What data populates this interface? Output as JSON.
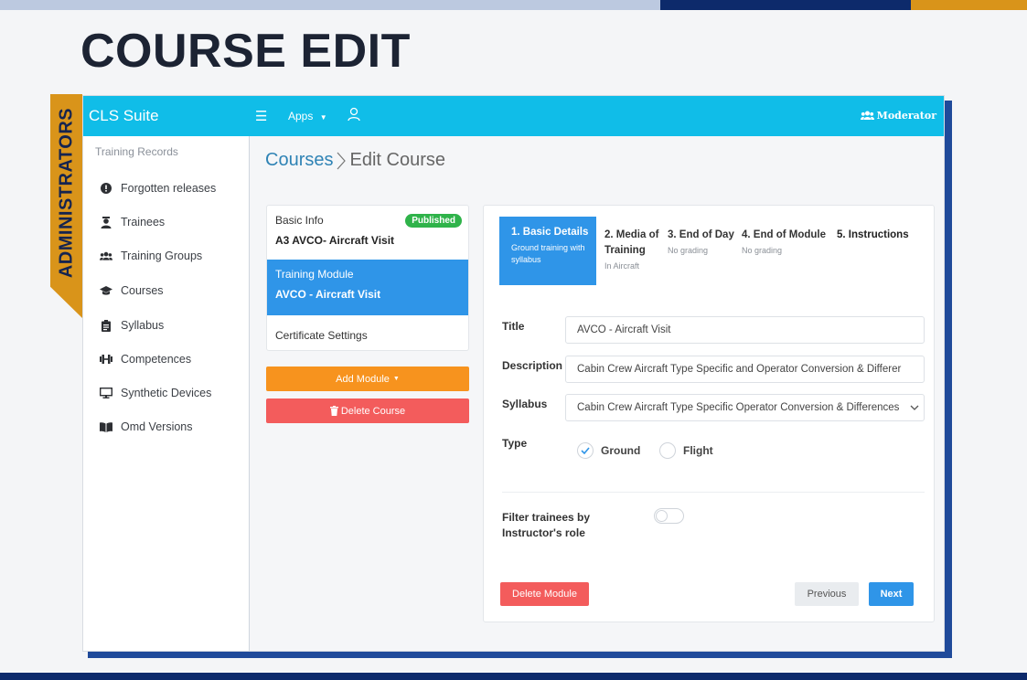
{
  "slide": {
    "title": "COURSE EDIT",
    "side_tab": "ADMINISTRATORS"
  },
  "colors": {
    "accent": "#10bde8",
    "primary_blue": "#2f95e8",
    "orange": "#f7931e",
    "danger": "#f35c5c",
    "success": "#2fb34a",
    "navy": "#0d2a6b",
    "gold": "#d9941a"
  },
  "navbar": {
    "brand": "CLS Suite",
    "menu_icon": "hamburger-icon",
    "apps_label": "Apps",
    "user_icon": "user-icon",
    "role_label": "Moderator",
    "role_icon": "users-icon"
  },
  "sidebar": {
    "heading": "Training Records",
    "items": [
      {
        "label": "Forgotten releases",
        "icon": "exclamation-circle-icon"
      },
      {
        "label": "Trainees",
        "icon": "user-graduate-icon"
      },
      {
        "label": "Training Groups",
        "icon": "users-icon"
      },
      {
        "label": "Courses",
        "icon": "graduation-cap-icon"
      },
      {
        "label": "Syllabus",
        "icon": "clipboard-icon"
      },
      {
        "label": "Competences",
        "icon": "dumbbell-icon"
      },
      {
        "label": "Synthetic Devices",
        "icon": "monitor-icon"
      },
      {
        "label": "Omd Versions",
        "icon": "book-icon"
      }
    ]
  },
  "breadcrumb": {
    "parent": "Courses",
    "current": "Edit Course"
  },
  "module_card": {
    "basic_label": "Basic Info",
    "badge": "Published",
    "course_title": "A3 AVCO- Aircraft Visit",
    "module_label": "Training Module",
    "module_title": "AVCO - Aircraft Visit",
    "certificate_label": "Certificate Settings"
  },
  "actions": {
    "add_module": "Add Module",
    "delete_course": "Delete Course"
  },
  "steps": [
    {
      "title": "1. Basic Details",
      "sub": "Ground training with syllabus"
    },
    {
      "title": "2. Media of Training",
      "sub": "In Aircraft"
    },
    {
      "title": "3. End of Day",
      "sub": "No grading"
    },
    {
      "title": "4. End of Module",
      "sub": "No grading"
    },
    {
      "title": "5. Instructions",
      "sub": ""
    }
  ],
  "form": {
    "title_label": "Title",
    "title_value": "AVCO - Aircraft Visit",
    "description_label": "Description",
    "description_value": "Cabin Crew Aircraft Type Specific and  Operator Conversion & Differer",
    "syllabus_label": "Syllabus",
    "syllabus_value": "Cabin Crew Aircraft Type Specific Operator Conversion & Differences",
    "type_label": "Type",
    "type_options": [
      "Ground",
      "Flight"
    ],
    "type_selected": "Ground",
    "filter_label_line1": "Filter trainees by",
    "filter_label_line2": "Instructor's role",
    "filter_enabled": false
  },
  "footer_buttons": {
    "delete_module": "Delete Module",
    "previous": "Previous",
    "next": "Next"
  }
}
